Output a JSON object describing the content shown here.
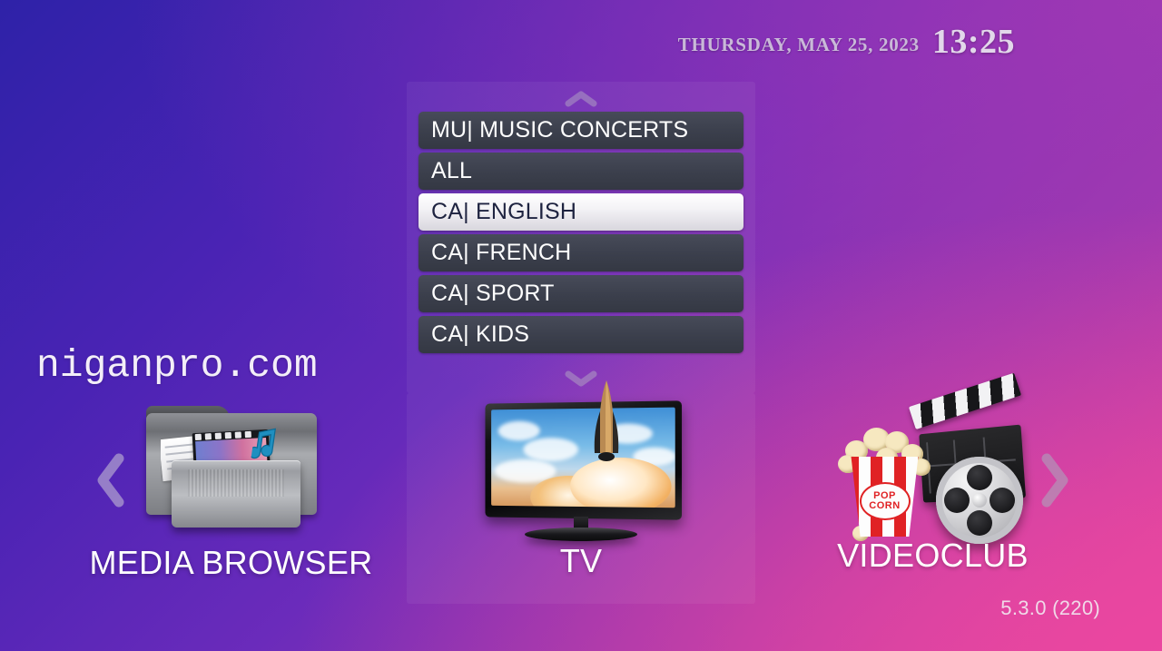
{
  "header": {
    "date": "THURSDAY, MAY 25, 2023",
    "time": "13:25",
    "date_color": "#c9b9d8",
    "time_color": "#e2d7ea"
  },
  "watermark": {
    "text": "niganpro.com"
  },
  "channel_list": {
    "scroll_up_icon": "chevron-up-icon",
    "scroll_down_icon": "chevron-down-icon",
    "selected_index": 2,
    "items": [
      {
        "label": "MU| MUSIC CONCERTS",
        "selected": false
      },
      {
        "label": "ALL",
        "selected": false
      },
      {
        "label": "CA| ENGLISH",
        "selected": true
      },
      {
        "label": "CA| FRENCH",
        "selected": false
      },
      {
        "label": "CA| SPORT",
        "selected": false
      },
      {
        "label": "CA| KIDS",
        "selected": false
      }
    ],
    "item_background": "#3e4250",
    "item_text_color": "#ffffff",
    "selected_background": "#f4f3f6",
    "selected_text_color": "#1e2340"
  },
  "apps": {
    "prev_icon": "chevron-left-icon",
    "next_icon": "chevron-right-icon",
    "tiles": [
      {
        "label": "MEDIA BROWSER",
        "icon": "media-folder-icon",
        "focused": false
      },
      {
        "label": "TV",
        "icon": "television-icon",
        "focused": true
      },
      {
        "label": "VIDEOCLUB",
        "icon": "popcorn-clapperboard-film-reel-icon",
        "focused": false
      }
    ]
  },
  "footer": {
    "version": "5.3.0 (220)"
  },
  "theme": {
    "gradient_top_left": "#2e22a8",
    "gradient_top_right": "#9b38ae",
    "gradient_bottom_left": "#5526b5",
    "gradient_bottom_right": "#e6489c",
    "chevron_color": "#b9b3c6"
  },
  "popcorn": {
    "line1": "POP",
    "line2": "CORN"
  }
}
